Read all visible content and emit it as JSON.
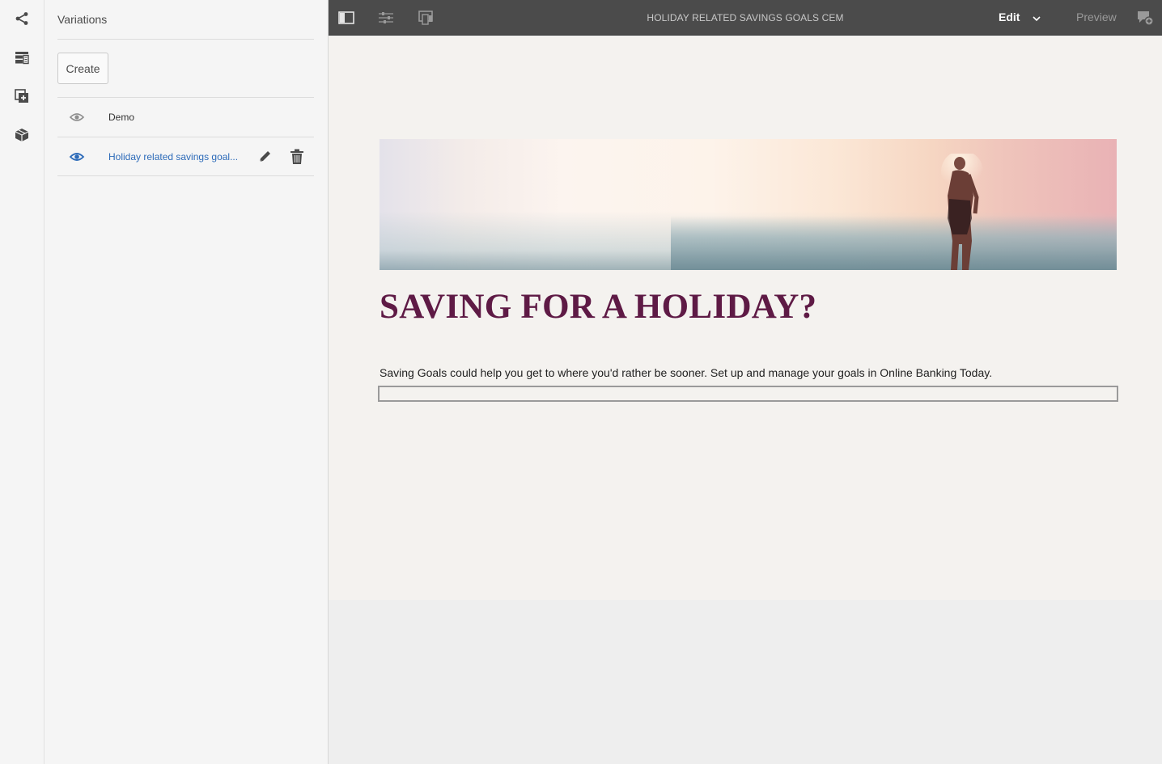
{
  "rail": {
    "icons": [
      "share-icon",
      "content-tree-icon",
      "add-component-icon",
      "assets-cube-icon"
    ]
  },
  "panel": {
    "title": "Variations",
    "create_label": "Create",
    "variations": [
      {
        "label": "Demo",
        "color": "#323232",
        "eye_color": "#8e8e8e"
      },
      {
        "label": "Holiday related savings goal...",
        "color": "#2d6bb9",
        "eye_color": "#2d6bb9"
      }
    ]
  },
  "toolbar": {
    "title": "HOLIDAY RELATED SAVINGS GOALS CEM",
    "mode_label": "Edit",
    "preview_label": "Preview",
    "icons": [
      "toggle-side-panel-icon",
      "page-properties-icon",
      "emulator-icon",
      "annotations-icon",
      "chevron-down-icon"
    ]
  },
  "content": {
    "headline": "SAVING FOR A HOLIDAY?",
    "body": "Saving Goals could help you get to where you'd rather be sooner. Set up and manage your goals in Online Banking Today.",
    "headline_color": "#5e1a45"
  }
}
